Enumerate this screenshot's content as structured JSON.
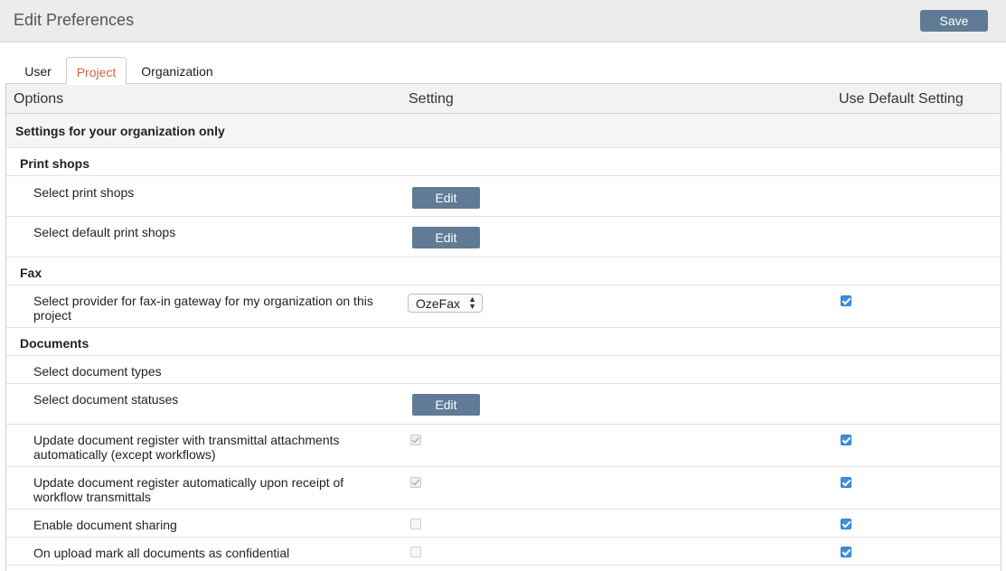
{
  "header": {
    "title": "Edit Preferences",
    "save_label": "Save"
  },
  "tabs": [
    {
      "label": "User",
      "active": false
    },
    {
      "label": "Project",
      "active": true
    },
    {
      "label": "Organization",
      "active": false
    }
  ],
  "table": {
    "columns": [
      "Options",
      "Setting",
      "Use Default Setting"
    ],
    "section_title": "Settings for your organization only",
    "groups": {
      "print_shops": "Print shops",
      "fax": "Fax",
      "documents": "Documents"
    },
    "rows": {
      "select_print_shops": {
        "label": "Select print shops",
        "button": "Edit"
      },
      "select_default_print_shops": {
        "label": "Select default print shops",
        "button": "Edit"
      },
      "fax_provider": {
        "label_line1": "Select provider for fax-in gateway for my organization on this",
        "label_line2": "project",
        "selected": "OzeFax",
        "use_default": true
      },
      "document_types": {
        "label": "Select document types"
      },
      "document_statuses": {
        "label": "Select document statuses",
        "button": "Edit"
      },
      "update_register_transmittal": {
        "label_line1": "Update document register with transmittal attachments",
        "label_line2": "automatically (except workflows)",
        "setting_checked": true,
        "setting_disabled": true,
        "use_default": true
      },
      "update_register_workflow": {
        "label_line1": "Update document register automatically upon receipt of",
        "label_line2": "workflow transmittals",
        "setting_checked": true,
        "setting_disabled": true,
        "use_default": true
      },
      "document_sharing": {
        "label": "Enable document sharing",
        "setting_checked": false,
        "setting_disabled": true,
        "use_default": true
      },
      "mark_confidential": {
        "label": "On upload mark all documents as confidential",
        "setting_checked": false,
        "setting_disabled": true,
        "use_default": true
      }
    }
  },
  "colors": {
    "accent_tab": "#d2643c",
    "button": "#5f7b95",
    "checkbox": "#3d8ee2"
  }
}
